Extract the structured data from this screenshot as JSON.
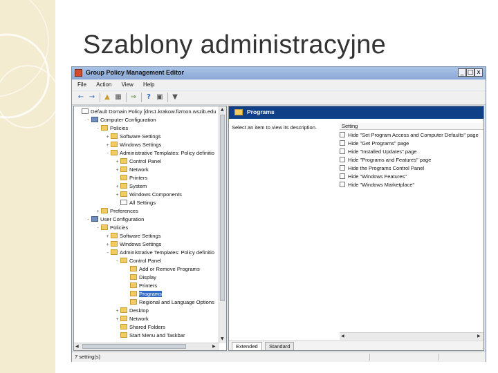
{
  "slide": {
    "title": "Szablony administracyjne",
    "accent_color": "#f4ecd0"
  },
  "window": {
    "title": "Group Policy Management Editor",
    "controls": [
      "_",
      "□",
      "x"
    ]
  },
  "menu": [
    "File",
    "Action",
    "View",
    "Help"
  ],
  "toolbar_icons": [
    "back-arrow-icon",
    "forward-arrow-icon",
    "up-folder-icon",
    "show-hide-tree-icon",
    "export-list-icon",
    "help-icon",
    "properties-icon",
    "filter-icon"
  ],
  "tree": [
    {
      "label": "Default Domain Policy [dns1.krakow.fizmon.wszib.edu",
      "indent": 0,
      "icon": "doc",
      "exp": ""
    },
    {
      "label": "Computer Configuration",
      "indent": 1,
      "icon": "computer",
      "exp": "-"
    },
    {
      "label": "Policies",
      "indent": 2,
      "icon": "folder",
      "exp": "-"
    },
    {
      "label": "Software Settings",
      "indent": 3,
      "icon": "folder",
      "exp": "+"
    },
    {
      "label": "Windows Settings",
      "indent": 3,
      "icon": "folder",
      "exp": "+"
    },
    {
      "label": "Administrative Templates: Policy definitio",
      "indent": 3,
      "icon": "folder",
      "exp": "-"
    },
    {
      "label": "Control Panel",
      "indent": 4,
      "icon": "folder",
      "exp": "+"
    },
    {
      "label": "Network",
      "indent": 4,
      "icon": "folder",
      "exp": "+"
    },
    {
      "label": "Printers",
      "indent": 4,
      "icon": "folder",
      "exp": ""
    },
    {
      "label": "System",
      "indent": 4,
      "icon": "folder",
      "exp": "+"
    },
    {
      "label": "Windows Components",
      "indent": 4,
      "icon": "folder",
      "exp": "+"
    },
    {
      "label": "All Settings",
      "indent": 4,
      "icon": "doc",
      "exp": ""
    },
    {
      "label": "Preferences",
      "indent": 2,
      "icon": "folder",
      "exp": "+"
    },
    {
      "label": "User Configuration",
      "indent": 1,
      "icon": "computer",
      "exp": "-"
    },
    {
      "label": "Policies",
      "indent": 2,
      "icon": "folder",
      "exp": "-"
    },
    {
      "label": "Software Settings",
      "indent": 3,
      "icon": "folder",
      "exp": "+"
    },
    {
      "label": "Windows Settings",
      "indent": 3,
      "icon": "folder",
      "exp": "+"
    },
    {
      "label": "Administrative Templates: Policy definitio",
      "indent": 3,
      "icon": "folder",
      "exp": "-"
    },
    {
      "label": "Control Panel",
      "indent": 4,
      "icon": "folder",
      "exp": "-"
    },
    {
      "label": "Add or Remove Programs",
      "indent": 5,
      "icon": "folder",
      "exp": ""
    },
    {
      "label": "Display",
      "indent": 5,
      "icon": "folder",
      "exp": ""
    },
    {
      "label": "Printers",
      "indent": 5,
      "icon": "folder",
      "exp": ""
    },
    {
      "label": "Programs",
      "indent": 5,
      "icon": "folder",
      "exp": "",
      "selected": true
    },
    {
      "label": "Regional and Language Options",
      "indent": 5,
      "icon": "folder",
      "exp": ""
    },
    {
      "label": "Desktop",
      "indent": 4,
      "icon": "folder",
      "exp": "+"
    },
    {
      "label": "Network",
      "indent": 4,
      "icon": "folder",
      "exp": "+"
    },
    {
      "label": "Shared Folders",
      "indent": 4,
      "icon": "folder",
      "exp": ""
    },
    {
      "label": "Start Menu and Taskbar",
      "indent": 4,
      "icon": "folder",
      "exp": ""
    }
  ],
  "right_panel": {
    "header": "Programs",
    "description": "Select an item to view its description.",
    "column_header": "Setting",
    "settings": [
      "Hide \"Set Program Access and Computer Defaults\" page",
      "Hide \"Get Programs\" page",
      "Hide \"Installed Updates\" page",
      "Hide \"Programs and Features\" page",
      "Hide the Programs Control Panel",
      "Hide \"Windows Features\"",
      "Hide \"Windows Marketplace\""
    ],
    "tabs": [
      "Extended",
      "Standard"
    ]
  },
  "status": {
    "text": "7 setting(s)"
  }
}
